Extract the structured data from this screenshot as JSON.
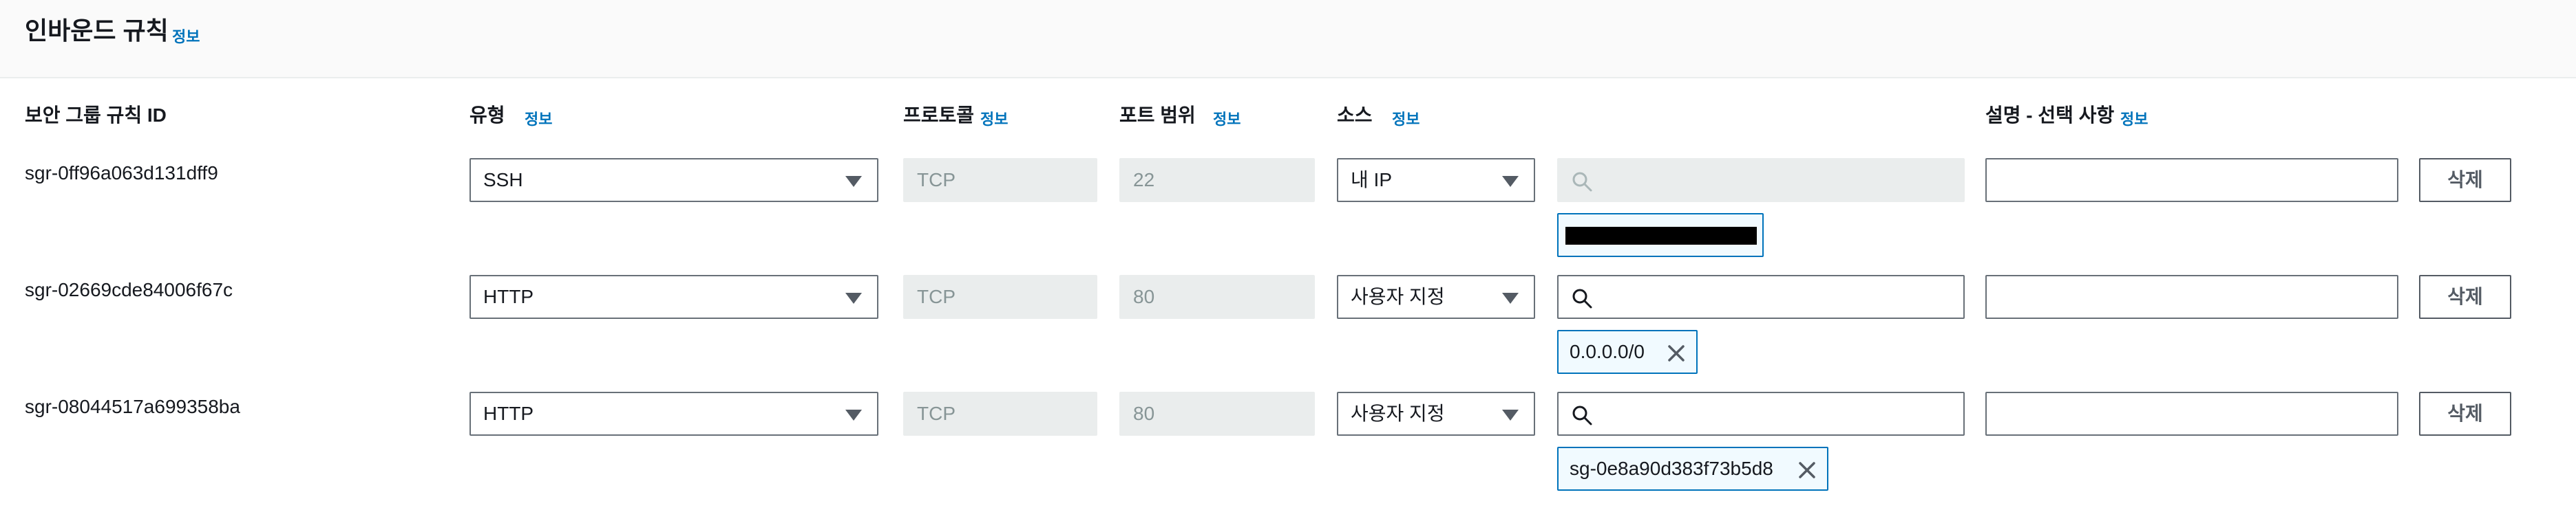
{
  "section": {
    "title": "인바운드 규칙",
    "info_label": "정보"
  },
  "columns": {
    "rule_id": "보안 그룹 규칙 ID",
    "type": "유형",
    "protocol": "프로토콜",
    "port_range": "포트 범위",
    "source": "소스",
    "description": "설명 - 선택 사항",
    "info_label": "정보"
  },
  "rules": [
    {
      "id": "sgr-0ff96a063d131dff9",
      "type": "SSH",
      "protocol": "TCP",
      "port_range": "22",
      "source": "내 IP",
      "search_disabled": true,
      "token": "",
      "delete_label": "삭제"
    },
    {
      "id": "sgr-02669cde84006f67c",
      "type": "HTTP",
      "protocol": "TCP",
      "port_range": "80",
      "source": "사용자 지정",
      "search_disabled": false,
      "token": "0.0.0.0/0",
      "delete_label": "삭제"
    },
    {
      "id": "sgr-08044517a699358ba",
      "type": "HTTP",
      "protocol": "TCP",
      "port_range": "80",
      "source": "사용자 지정",
      "search_disabled": false,
      "token": "sg-0e8a90d383f73b5d8",
      "delete_label": "삭제"
    }
  ],
  "icons": {
    "search": "search-icon",
    "dropdown": "caret-down-icon",
    "remove": "close-icon"
  },
  "colors": {
    "link": "#0073bb",
    "border": "#687078",
    "readonly_bg": "#eaeded",
    "token_bg": "#f1faff"
  }
}
